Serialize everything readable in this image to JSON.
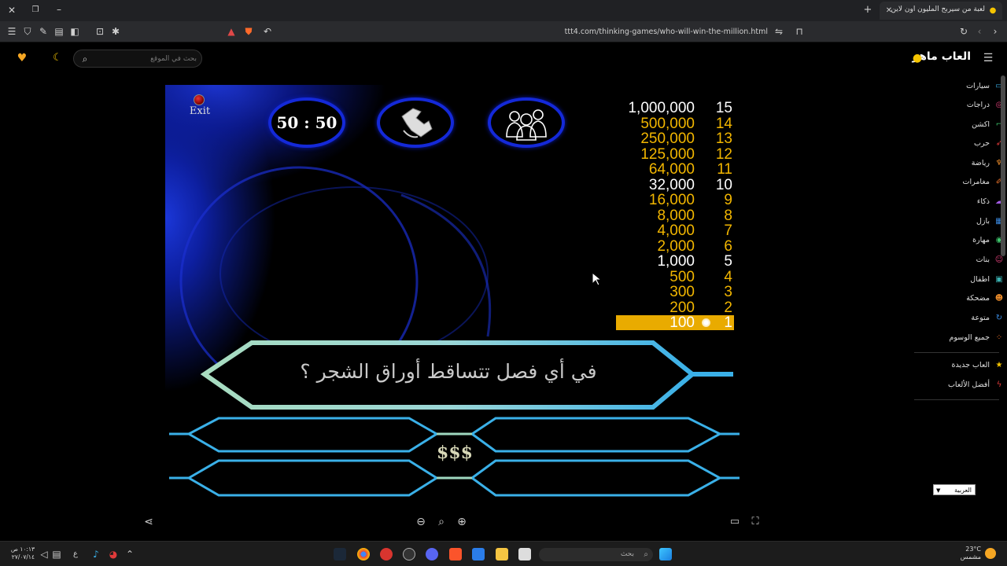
{
  "browser": {
    "tab_title": "لعبة من سيربح المليون اون لاين",
    "url": "ttt4.com/thinking-games/who-will-win-the-million.html"
  },
  "site": {
    "logo": "العاب ماهر",
    "search_placeholder": "بحث في الموقع"
  },
  "sidebar": {
    "categories": [
      "سيارات",
      "دراجات",
      "اكشن",
      "حرب",
      "رياضة",
      "مغامرات",
      "ذكاء",
      "بازل",
      "مهارة",
      "بنات",
      "اطفال",
      "مضحكة",
      "متوعة",
      "جميع الوسوم"
    ],
    "extras": [
      "العاب جديدة",
      "أفضل الألعاب"
    ],
    "language": "العربية"
  },
  "game": {
    "exit_label": "Exit",
    "lifeline_fifty": "50 : 50",
    "question": "في أي فصل تتساقط أوراق الشجر ؟",
    "center_logo": "$$$",
    "prizes": [
      {
        "level": "15",
        "amount": "1,000,000",
        "style": "white"
      },
      {
        "level": "14",
        "amount": "500,000",
        "style": "gold"
      },
      {
        "level": "13",
        "amount": "250,000",
        "style": "gold"
      },
      {
        "level": "12",
        "amount": "125,000",
        "style": "gold"
      },
      {
        "level": "11",
        "amount": "64,000",
        "style": "gold"
      },
      {
        "level": "10",
        "amount": "32,000",
        "style": "white"
      },
      {
        "level": "9",
        "amount": "16,000",
        "style": "gold"
      },
      {
        "level": "8",
        "amount": "8,000",
        "style": "gold"
      },
      {
        "level": "7",
        "amount": "4,000",
        "style": "gold"
      },
      {
        "level": "6",
        "amount": "2,000",
        "style": "gold"
      },
      {
        "level": "5",
        "amount": "1,000",
        "style": "white"
      },
      {
        "level": "4",
        "amount": "500",
        "style": "gold"
      },
      {
        "level": "3",
        "amount": "300",
        "style": "gold"
      },
      {
        "level": "2",
        "amount": "200",
        "style": "gold"
      },
      {
        "level": "1",
        "amount": "100",
        "style": "current"
      }
    ]
  },
  "taskbar": {
    "search_placeholder": "بحث",
    "weather_temp": "23°C",
    "weather_desc": "مشمس",
    "time": "١٠:١٣ ص",
    "date": "٢٧/٠٧/١٤",
    "lang": "ع"
  },
  "colors": {
    "gold": "#f2b600",
    "lifeline_ring": "#1429d8",
    "frame_cyan": "#3ab0e8",
    "frame_mint": "#9fd8c0"
  }
}
